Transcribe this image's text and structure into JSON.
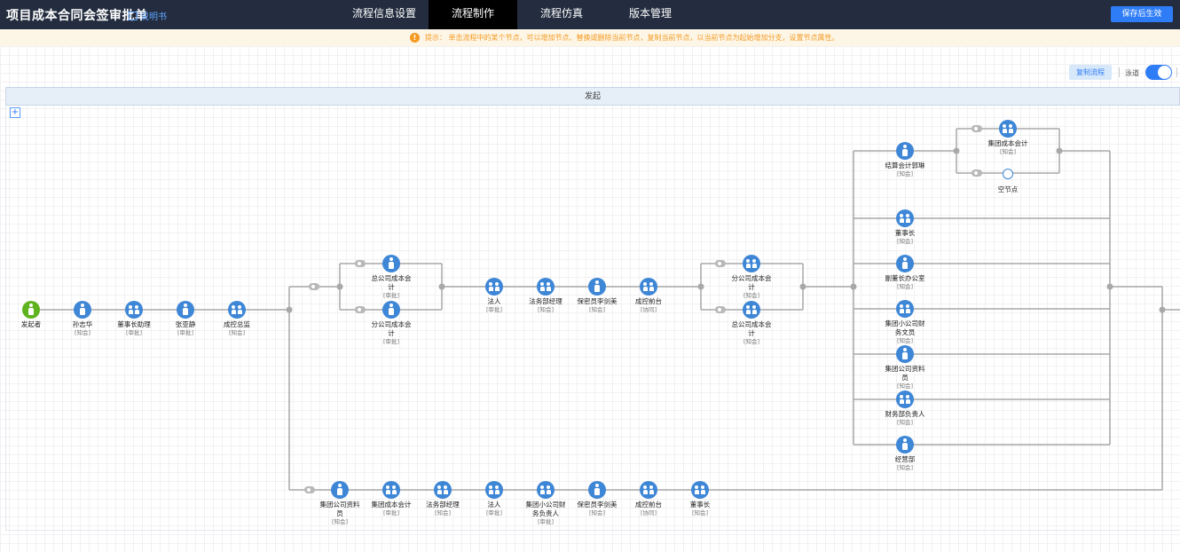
{
  "header": {
    "title": "项目成本合同会签审批单",
    "manual_label": "说明书",
    "tabs": [
      {
        "label": "流程信息设置"
      },
      {
        "label": "流程制作"
      },
      {
        "label": "流程仿真"
      },
      {
        "label": "版本管理"
      }
    ],
    "active_tab": "流程制作",
    "save_label": "保存后生效"
  },
  "hint": {
    "icon": "!",
    "text": "提示： 单击流程中的某个节点，可以增加节点、替换或删除当前节点，复制当前节点，以当前节点为起始增加分支，设置节点属性。"
  },
  "toolbar": {
    "copy_label": "复制流程",
    "lane_label": "泳道",
    "lane_enabled": true
  },
  "lane": {
    "header": "发起",
    "add_icon": "+"
  },
  "colors": {
    "accent": "#2e7cf6",
    "node": "#3e86d6",
    "start": "#5fb31f",
    "hint": "#f59a23",
    "topbar": "#232d3f"
  },
  "nodes": [
    {
      "name": "发起者",
      "role": "",
      "icon": "start-person"
    },
    {
      "name": "孙志华",
      "role": "[知会]",
      "icon": "person"
    },
    {
      "name": "董事长助理",
      "role": "[审批]",
      "icon": "group"
    },
    {
      "name": "张亚静",
      "role": "[审批]",
      "icon": "person"
    },
    {
      "name": "成控总监",
      "role": "[知会]",
      "icon": "group"
    },
    {
      "name": "总公司成本会计",
      "role": "[审批]",
      "icon": "person"
    },
    {
      "name": "分公司成本会计",
      "role": "[审批]",
      "icon": "person"
    },
    {
      "name": "法人",
      "role": "[审批]",
      "icon": "group"
    },
    {
      "name": "法务部经理",
      "role": "[知会]",
      "icon": "group"
    },
    {
      "name": "保密员李剑美",
      "role": "[知会]",
      "icon": "person"
    },
    {
      "name": "成控前台",
      "role": "[协同]",
      "icon": "group"
    },
    {
      "name": "分公司成本会计",
      "role": "[知会]",
      "icon": "group"
    },
    {
      "name": "总公司成本会计",
      "role": "[知会]",
      "icon": "group"
    },
    {
      "name": "结算会计郭琳",
      "role": "[知会]",
      "icon": "person"
    },
    {
      "name": "集团成本会计",
      "role": "[知会]",
      "icon": "group"
    },
    {
      "name": "空节点",
      "role": "",
      "icon": "empty"
    },
    {
      "name": "董事长",
      "role": "[知会]",
      "icon": "group"
    },
    {
      "name": "副董长办公室",
      "role": "[知会]",
      "icon": "person"
    },
    {
      "name": "集团小公司财务文员",
      "role": "[知会]",
      "icon": "group"
    },
    {
      "name": "集团公司资料员",
      "role": "[知会]",
      "icon": "person"
    },
    {
      "name": "财务部负责人",
      "role": "[知会]",
      "icon": "group"
    },
    {
      "name": "经营部",
      "role": "[知会]",
      "icon": "person"
    },
    {
      "name": "集团公司资料员",
      "role": "[知会]",
      "icon": "person"
    },
    {
      "name": "集团成本会计",
      "role": "[审批]",
      "icon": "group"
    },
    {
      "name": "法务部经理",
      "role": "[知会]",
      "icon": "group"
    },
    {
      "name": "法人",
      "role": "[审批]",
      "icon": "group"
    },
    {
      "name": "集团小公司财务负责人",
      "role": "[审批]",
      "icon": "group"
    },
    {
      "name": "保密员李剑美",
      "role": "[知会]",
      "icon": "person"
    },
    {
      "name": "成控前台",
      "role": "[协同]",
      "icon": "group"
    },
    {
      "name": "董事长",
      "role": "[知会]",
      "icon": "group"
    }
  ]
}
